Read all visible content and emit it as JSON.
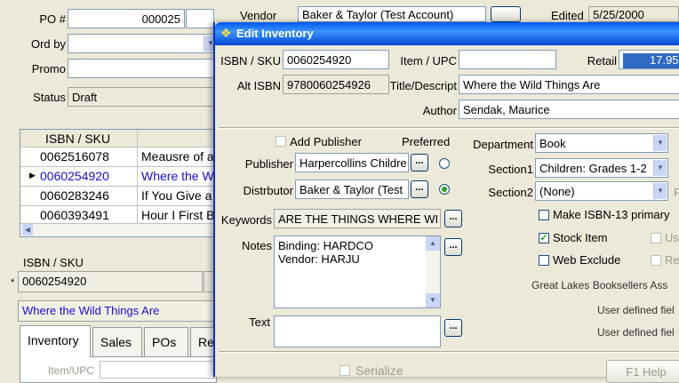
{
  "bg": {
    "po_label": "PO #",
    "po_value": "000025",
    "vendor_label": "Vendor",
    "vendor_value": "Baker & Taylor (Test Account)",
    "edited_label": "Edited",
    "edited_value": "5/25/2000",
    "ord_by_label": "Ord by",
    "promo_label": "Promo",
    "status_label": "Status",
    "status_value": "Draft",
    "grid": {
      "header": "ISBN / SKU",
      "rows": [
        {
          "sku": "0062516078",
          "title": "Meausre of a M"
        },
        {
          "sku": "0060254920",
          "title": "Where the Wild"
        },
        {
          "sku": "0060283246",
          "title": "If You Give a C"
        },
        {
          "sku": "0060393491",
          "title": "Hour I First Be"
        }
      ]
    },
    "sku_label": "ISBN / SKU",
    "sku_star": "*",
    "sku_value": "0060254920",
    "title_value": "Where the Wild Things Are",
    "tabs": [
      "Inventory",
      "Sales",
      "POs",
      "Re"
    ],
    "item_upc_label": "Item/UPC"
  },
  "dialog": {
    "title": "Edit Inventory",
    "isbn_label": "ISBN / SKU",
    "isbn_value": "0060254920",
    "item_upc_label": "Item / UPC",
    "item_upc_value": "",
    "retail_label": "Retail",
    "retail_value": "17.95",
    "alt_isbn_label": "Alt ISBN",
    "alt_isbn_value": "9780060254926",
    "title_label": "Title/Descript",
    "title_value": "Where the Wild Things Are",
    "author_label": "Author",
    "author_value": "Sendak, Maurice",
    "add_publisher_label": "Add Publisher",
    "preferred_label": "Preferred",
    "publisher_label": "Publisher",
    "publisher_value": "Harpercollins Childre",
    "distributor_label": "Distrbutor",
    "distributor_value": "Baker & Taylor (Test",
    "ellipsis": "...",
    "department_label": "Department",
    "department_value": "Book",
    "section1_label": "Section1",
    "section1_value": "Children: Grades 1-2",
    "section2_label": "Section2",
    "section2_value": "(None)",
    "section2_trail": "F",
    "keywords_label": "Keywords",
    "keywords_value": "ARE THE THINGS WHERE WI",
    "notes_label": "Notes",
    "notes_line1": "Binding: HARDCO",
    "notes_line2": "Vendor: HARJU",
    "make_isbn13_label": "Make ISBN-13 primary",
    "stock_item_label": "Stock Item",
    "stock_item_checked": true,
    "web_exclude_label": "Web Exclude",
    "us_label": "Us",
    "re_label": "Re",
    "great_lakes_label": "Great Lakes Booksellers Ass",
    "user_defined_1": "User defined fiel",
    "user_defined_2": "User defined fiel",
    "text_label": "Text",
    "serialize_label": "Serialize",
    "help_label": "F1 Help"
  },
  "colors": {
    "titlebar_start": "#0058ee",
    "titlebar_end": "#3d95ff",
    "dialog_bg": "#ece9d8",
    "selected_text": "#1a0dd5",
    "retail_highlight": "#316ac5"
  }
}
